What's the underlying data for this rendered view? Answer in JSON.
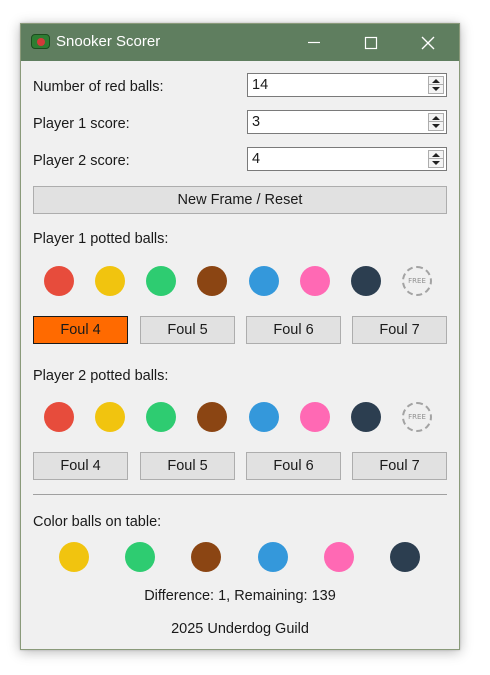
{
  "window": {
    "title": "Snooker Scorer",
    "app_icon": "snooker-table-icon",
    "controls": [
      "minimize-icon",
      "maximize-icon",
      "close-icon"
    ]
  },
  "fields": [
    {
      "label": "Number of red balls:",
      "value": "14"
    },
    {
      "label": "Player 1 score:",
      "value": "3"
    },
    {
      "label": "Player 2 score:",
      "value": "4"
    }
  ],
  "reset_button": "New Frame / Reset",
  "player1": {
    "heading": "Player 1 potted balls:",
    "fouls": [
      "Foul 4",
      "Foul 5",
      "Foul 6",
      "Foul 7"
    ],
    "selected_foul": "Foul 4"
  },
  "player2": {
    "heading": "Player 2 potted balls:",
    "fouls": [
      "Foul 4",
      "Foul 5",
      "Foul 6",
      "Foul 7"
    ]
  },
  "ball_palette": [
    {
      "name": "red",
      "color": "#e74c3c"
    },
    {
      "name": "yellow",
      "color": "#f1c40f"
    },
    {
      "name": "green",
      "color": "#2ecc71"
    },
    {
      "name": "brown",
      "color": "#8b4513"
    },
    {
      "name": "blue",
      "color": "#3498db"
    },
    {
      "name": "pink",
      "color": "#ff69b4"
    },
    {
      "name": "black",
      "color": "#2c3e50"
    }
  ],
  "free_ball_label": "FREE",
  "table": {
    "heading": "Color balls on table:",
    "balls": [
      "yellow",
      "green",
      "brown",
      "blue",
      "pink",
      "black"
    ]
  },
  "status": "Difference: 1, Remaining: 139",
  "footer": "2025 Underdog Guild",
  "colors": {
    "titlebar": "#5f7e5f",
    "window_bg": "#f0f0f0",
    "foul_active": "#ff6a00"
  }
}
